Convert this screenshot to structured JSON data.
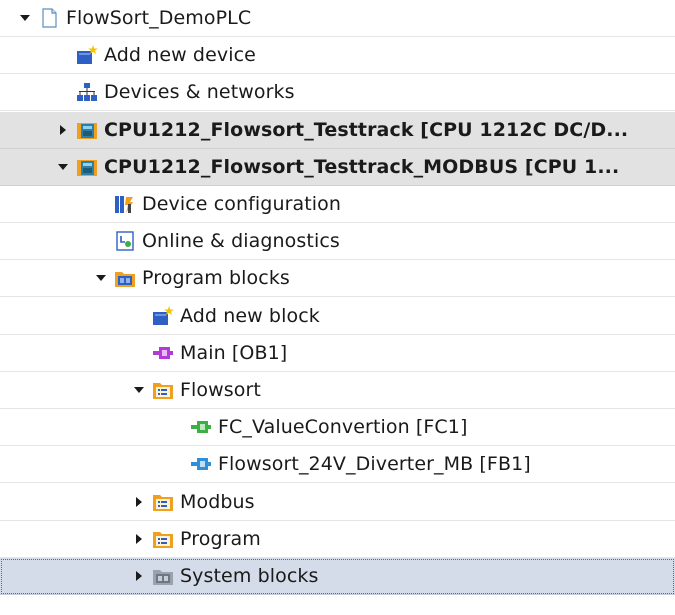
{
  "project_tree": {
    "items": [
      {
        "label": "FlowSort_DemoPLC",
        "level": 0,
        "expanded": true,
        "icon": "project-icon",
        "style": "normal"
      },
      {
        "label": "Add new device",
        "level": 1,
        "expanded": null,
        "icon": "add-new-device-icon",
        "style": "normal"
      },
      {
        "label": "Devices & networks",
        "level": 1,
        "expanded": null,
        "icon": "devices-networks-icon",
        "style": "normal"
      },
      {
        "label": "CPU1212_Flowsort_Testtrack [CPU 1212C DC/D...",
        "level": 1,
        "expanded": false,
        "icon": "cpu-icon",
        "style": "cpu"
      },
      {
        "label": "CPU1212_Flowsort_Testtrack_MODBUS [CPU 1...",
        "level": 1,
        "expanded": true,
        "icon": "cpu-icon",
        "style": "cpu"
      },
      {
        "label": "Device configuration",
        "level": 2,
        "expanded": null,
        "icon": "device-configuration-icon",
        "style": "normal"
      },
      {
        "label": "Online & diagnostics",
        "level": 2,
        "expanded": null,
        "icon": "online-diagnostics-icon",
        "style": "normal"
      },
      {
        "label": "Program blocks",
        "level": 2,
        "expanded": true,
        "icon": "program-blocks-folder-icon",
        "style": "normal"
      },
      {
        "label": "Add new block",
        "level": 3,
        "expanded": null,
        "icon": "add-new-block-icon",
        "style": "normal"
      },
      {
        "label": "Main [OB1]",
        "level": 3,
        "expanded": null,
        "icon": "ob-block-icon",
        "style": "normal"
      },
      {
        "label": "Flowsort",
        "level": 3,
        "expanded": true,
        "icon": "group-folder-icon",
        "style": "normal"
      },
      {
        "label": "FC_ValueConvertion [FC1]",
        "level": 4,
        "expanded": null,
        "icon": "fc-block-icon",
        "style": "normal"
      },
      {
        "label": "Flowsort_24V_Diverter_MB [FB1]",
        "level": 4,
        "expanded": null,
        "icon": "fb-block-icon",
        "style": "normal"
      },
      {
        "label": "Modbus",
        "level": 3,
        "expanded": false,
        "icon": "group-folder-icon",
        "style": "normal"
      },
      {
        "label": "Program",
        "level": 3,
        "expanded": false,
        "icon": "group-folder-icon",
        "style": "normal"
      },
      {
        "label": "System blocks",
        "level": 3,
        "expanded": false,
        "icon": "system-blocks-folder-icon",
        "style": "selected"
      }
    ]
  },
  "colors": {
    "cpu_row_bg": "#e2e2e2",
    "selected_row_bg": "#d5dce9",
    "folder_orange": "#f0a020",
    "ob_purple": "#b23bd8",
    "fc_green": "#3cb043",
    "fb_blue": "#2f8fd8"
  }
}
